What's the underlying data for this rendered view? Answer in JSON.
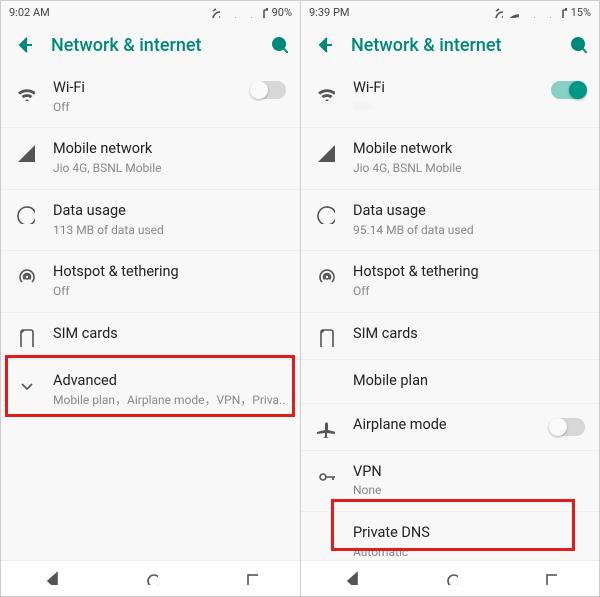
{
  "left": {
    "status": {
      "time": "9:02 AM",
      "battery": "90%"
    },
    "title": "Network & internet",
    "rows": {
      "wifi": {
        "label": "Wi-Fi",
        "sub": "Off"
      },
      "mobile": {
        "label": "Mobile network",
        "sub": "Jio 4G, BSNL Mobile"
      },
      "data": {
        "label": "Data usage",
        "sub": "113 MB of data used"
      },
      "hotspot": {
        "label": "Hotspot & tethering",
        "sub": "Off"
      },
      "sim": {
        "label": "SIM cards"
      },
      "adv": {
        "label": "Advanced",
        "sub": "Mobile plan，Airplane mode，VPN，Priva.."
      }
    }
  },
  "right": {
    "status": {
      "time": "9:39 PM",
      "battery": "15%"
    },
    "title": "Network & internet",
    "rows": {
      "wifi": {
        "label": "Wi-Fi",
        "sub": "——"
      },
      "mobile": {
        "label": "Mobile network",
        "sub": "Jio 4G, BSNL Mobile"
      },
      "data": {
        "label": "Data usage",
        "sub": "95.14 MB of data used"
      },
      "hotspot": {
        "label": "Hotspot & tethering",
        "sub": "Off"
      },
      "sim": {
        "label": "SIM cards"
      },
      "plan": {
        "label": "Mobile plan"
      },
      "air": {
        "label": "Airplane mode"
      },
      "vpn": {
        "label": "VPN",
        "sub": "None"
      },
      "pdns": {
        "label": "Private DNS",
        "sub": "Automatic"
      }
    }
  }
}
